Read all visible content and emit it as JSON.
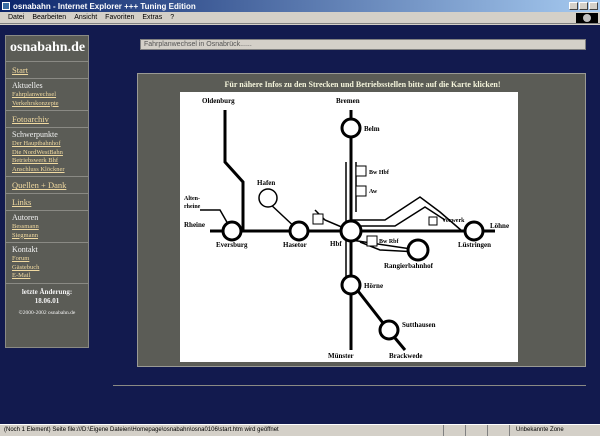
{
  "window": {
    "title": "osnabahn - Internet Explorer +++ Tuning Edition"
  },
  "menu": {
    "items": [
      "Datei",
      "Bearbeiten",
      "Ansicht",
      "Favoriten",
      "Extras",
      "?"
    ]
  },
  "sidebar": {
    "logo": "osnabahn.de",
    "start": "Start",
    "aktuelles": {
      "heading": "Aktuelles",
      "links": [
        "Fahrplanwechsel",
        "Verkehrskonzepte"
      ]
    },
    "fotoarchiv": "Fotoarchiv",
    "schwerpunkte": {
      "heading": "Schwerpunkte",
      "links": [
        "Der Hauptbahnhof",
        "Die NordWestBahn",
        "Betriebswerk Bhf",
        "Anschluss Klöckner"
      ]
    },
    "quellen": "Quellen + Dank",
    "links": "Links",
    "autoren": {
      "heading": "Autoren",
      "links": [
        "Bessmann",
        "Siegmann"
      ]
    },
    "kontakt": {
      "heading": "Kontakt",
      "links": [
        "Forum",
        "Gästebuch",
        "E-Mail"
      ]
    },
    "updated_label": "letzte Änderung:",
    "updated_date": "18.06.01",
    "copyright": "©2000-2002 osnabahn.de"
  },
  "search": {
    "value": "Fahrplanwechsel in Osnabrück......"
  },
  "map": {
    "heading": "Für nähere Infos zu den Strecken und Betriebsstellen bitte auf die Karte klicken!",
    "labels": {
      "oldenburg": "Oldenburg",
      "bremen": "Bremen",
      "belm": "Belm",
      "bw_hbf": "Bw Hbf",
      "aw": "Aw",
      "hafen": "Hafen",
      "altenrheine_1": "Alten-",
      "altenrheine_2": "rheine",
      "rheine": "Rheine",
      "eversburg": "Eversburg",
      "hasetor": "Hasetor",
      "hbf": "Hbf",
      "vorwerk": "Vorwerk",
      "loehne": "Löhne",
      "luestringen": "Lüstringen",
      "bw_rbf": "Bw Rbf",
      "rangierbahnhof": "Rangierbahnhof",
      "hoerne": "Hörne",
      "sutthausen": "Sutthausen",
      "brackwede": "Brackwede",
      "muenster": "Münster"
    }
  },
  "status": {
    "text": "(Noch 1 Element) Seite file:///D:\\Eigene Dateien\\Homepage\\osnabahn\\osna0106\\start.htm wird geöffnet",
    "zone": "Unbekannte Zone"
  },
  "colors": {
    "page_bg": "#121a4e",
    "panel_bg": "#5b5c56",
    "link": "#f0d9a0"
  }
}
